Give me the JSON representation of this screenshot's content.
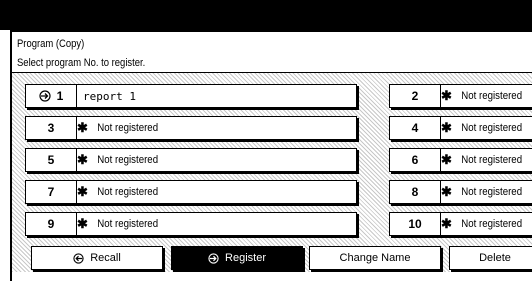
{
  "screen": {
    "title": "Program (Copy)",
    "prompt": "Select program No. to register."
  },
  "programs_left": [
    {
      "number": "1",
      "name": "report 1",
      "current": true
    },
    {
      "number": "3",
      "name": "Not registered"
    },
    {
      "number": "5",
      "name": "Not registered"
    },
    {
      "number": "7",
      "name": "Not registered"
    },
    {
      "number": "9",
      "name": "Not registered"
    }
  ],
  "programs_right": [
    {
      "number": "2",
      "name": "Not registered"
    },
    {
      "number": "4",
      "name": "Not registered"
    },
    {
      "number": "6",
      "name": "Not registered"
    },
    {
      "number": "8",
      "name": "Not registered"
    },
    {
      "number": "10",
      "name": "Not registered"
    }
  ],
  "buttons": {
    "recall": "Recall",
    "register": "Register",
    "change_name": "Change Name",
    "delete": "Delete"
  },
  "icons": {
    "arrow": "arrow-in-circle-icon",
    "star": "star-icon"
  },
  "colors": {
    "active_button_bg": "#000000",
    "hatch": "#c8c8c8"
  }
}
